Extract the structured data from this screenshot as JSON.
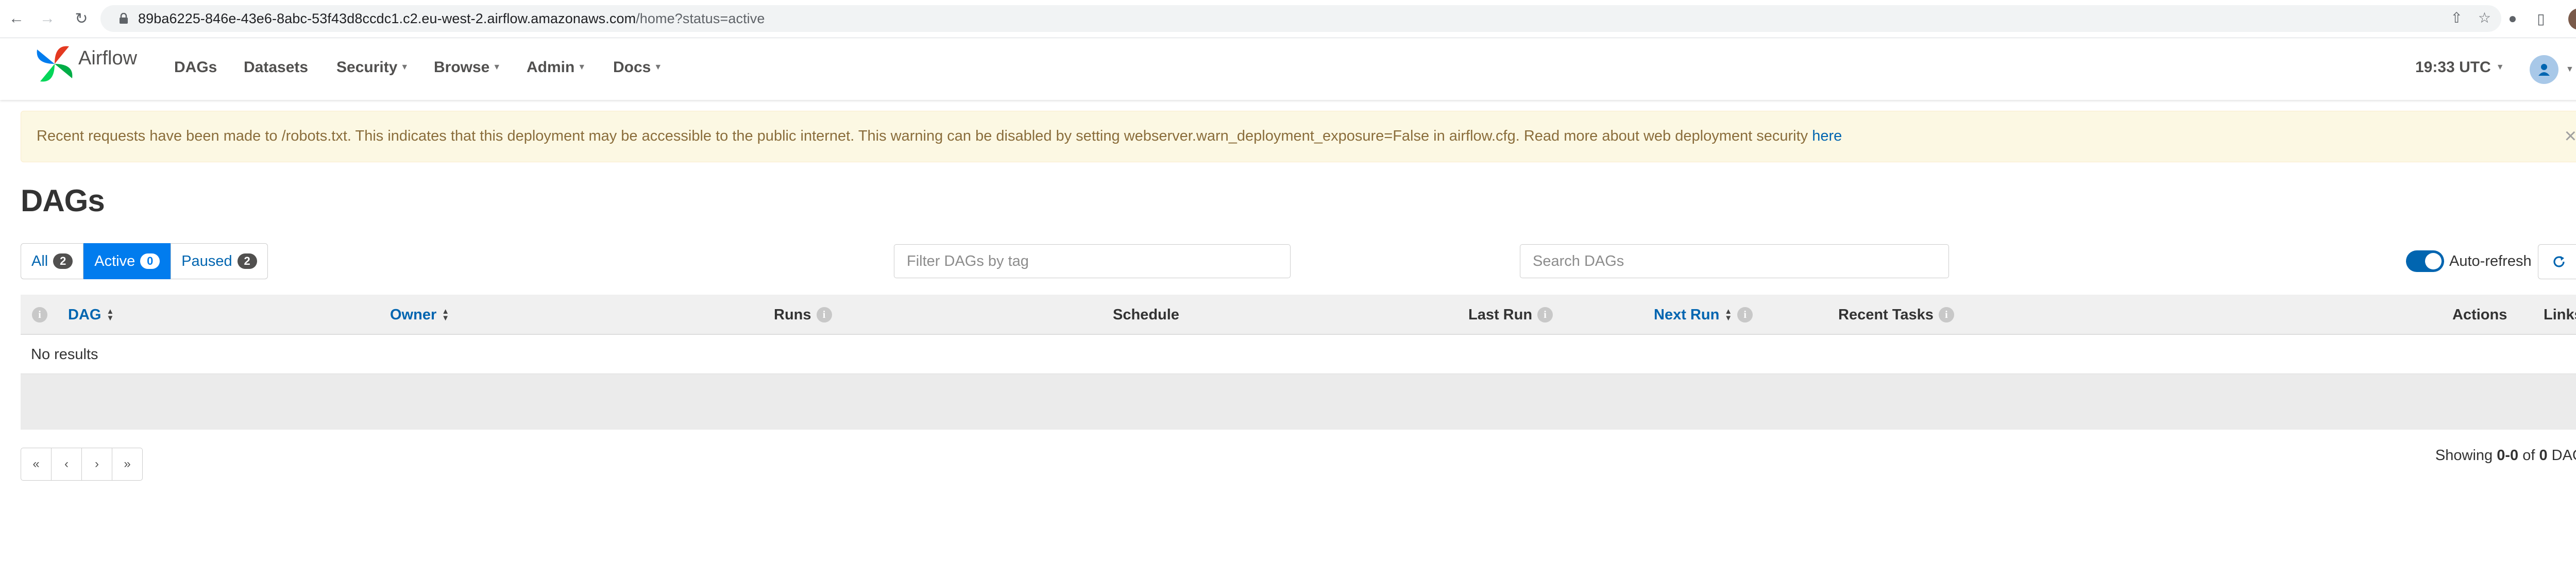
{
  "browser": {
    "url_host": "89ba6225-846e-43e6-8abc-53f43d8ccdc1.c2.eu-west-2.airflow.amazonaws.com",
    "url_path": "/home?status=active"
  },
  "navbar": {
    "brand": "Airflow",
    "items": [
      {
        "label": "DAGs",
        "dropdown": false
      },
      {
        "label": "Datasets",
        "dropdown": false
      },
      {
        "label": "Security",
        "dropdown": true
      },
      {
        "label": "Browse",
        "dropdown": true
      },
      {
        "label": "Admin",
        "dropdown": true
      },
      {
        "label": "Docs",
        "dropdown": true
      }
    ],
    "time": "19:33 UTC"
  },
  "alert": {
    "message": "Recent requests have been made to /robots.txt. This indicates that this deployment may be accessible to the public internet. This warning can be disabled by setting webserver.warn_deployment_exposure=False in airflow.cfg. Read more about web deployment security ",
    "link_text": "here",
    "close": "×"
  },
  "page": {
    "title": "DAGs"
  },
  "status_filter": [
    {
      "label": "All",
      "count": "2",
      "active": false
    },
    {
      "label": "Active",
      "count": "0",
      "active": true
    },
    {
      "label": "Paused",
      "count": "2",
      "active": false
    }
  ],
  "tag_filter": {
    "placeholder": "Filter DAGs by tag"
  },
  "search": {
    "placeholder": "Search DAGs"
  },
  "auto_refresh": {
    "label": "Auto-refresh",
    "enabled": true
  },
  "table": {
    "columns": {
      "dag": "DAG",
      "owner": "Owner",
      "runs": "Runs",
      "schedule": "Schedule",
      "last_run": "Last Run",
      "next_run": "Next Run",
      "recent_tasks": "Recent Tasks",
      "actions": "Actions",
      "links": "Links"
    },
    "empty_text": "No results"
  },
  "pagination": {
    "first": "«",
    "prev": "‹",
    "next": "›",
    "last": "»",
    "showing_prefix": "Showing ",
    "range": "0-0",
    "of": " of ",
    "total": "0",
    "suffix": " DAGs"
  },
  "colors": {
    "primary": "#017cee",
    "link": "#0165b0",
    "alert_bg": "#fcf8e3",
    "alert_text": "#8a6d3b"
  }
}
